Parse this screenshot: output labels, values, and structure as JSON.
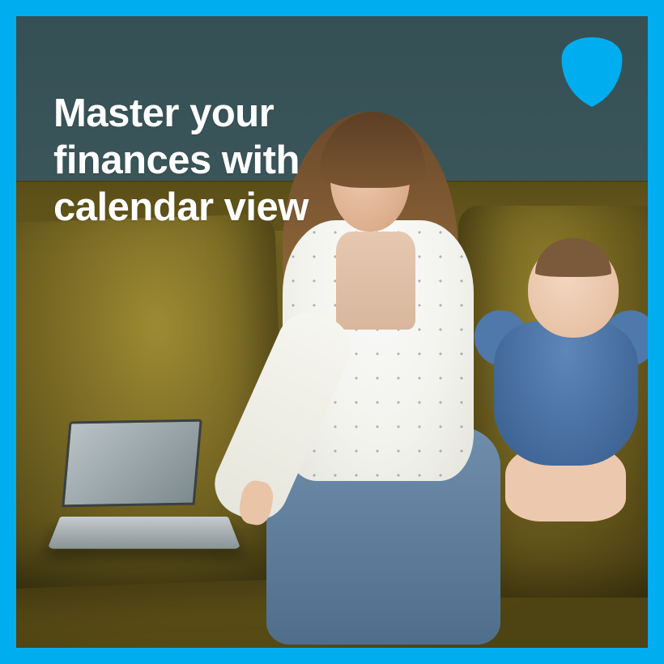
{
  "brand": {
    "logo_name": "eagle-shield-logo",
    "accent_color": "#00aeef"
  },
  "headline": {
    "text": "Master your finances with calendar view"
  }
}
